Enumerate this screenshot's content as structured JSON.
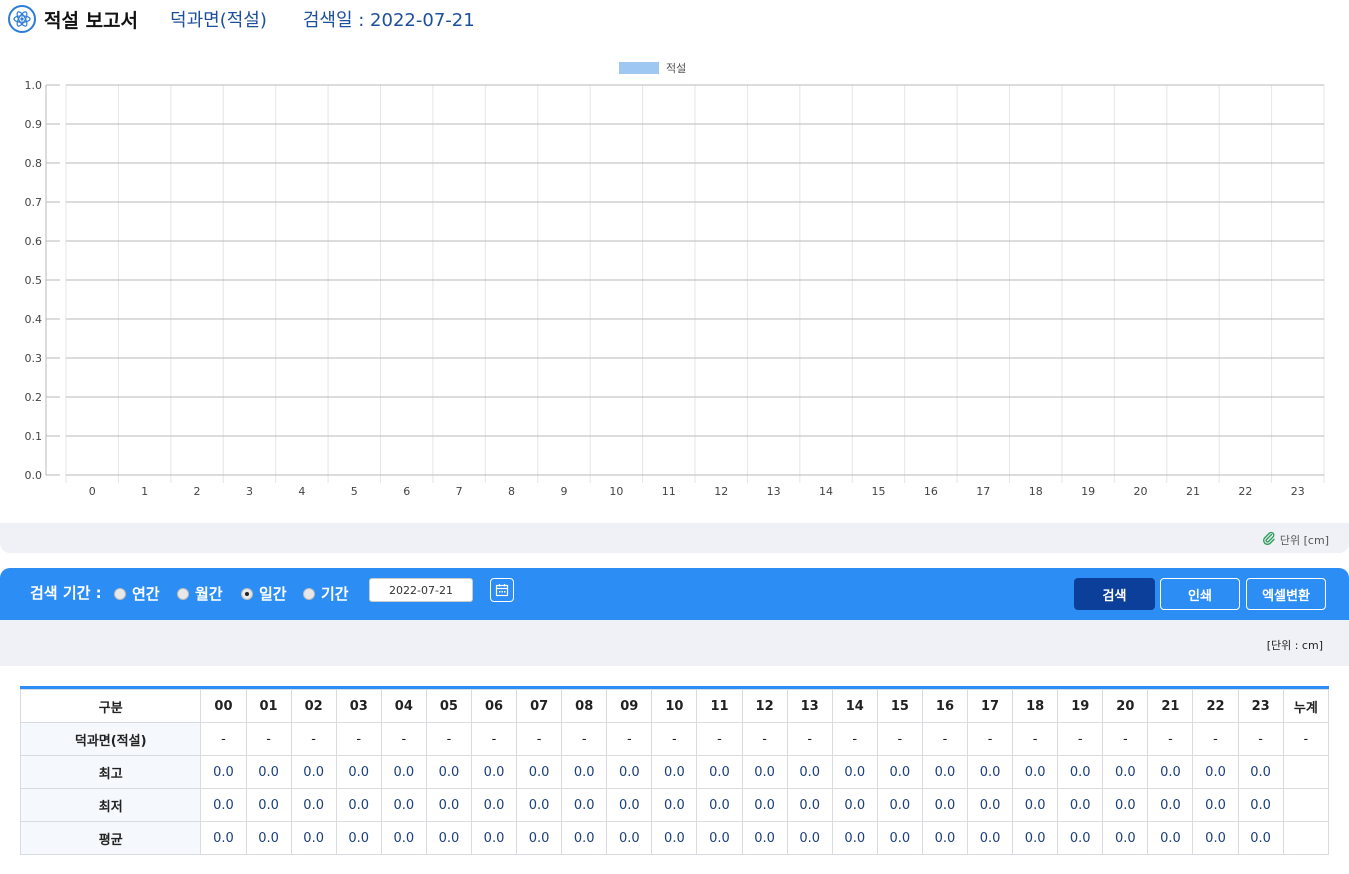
{
  "header": {
    "title": "적설 보고서",
    "station": "덕과면(적설)",
    "search_date_label": "검색일 : 2022-07-21"
  },
  "chart_data": {
    "type": "bar",
    "legend": [
      "적설"
    ],
    "series": [
      {
        "name": "적설",
        "color": "#9ec7f2",
        "values": [
          0,
          0,
          0,
          0,
          0,
          0,
          0,
          0,
          0,
          0,
          0,
          0,
          0,
          0,
          0,
          0,
          0,
          0,
          0,
          0,
          0,
          0,
          0,
          0
        ]
      }
    ],
    "categories": [
      "0",
      "1",
      "2",
      "3",
      "4",
      "5",
      "6",
      "7",
      "8",
      "9",
      "10",
      "11",
      "12",
      "13",
      "14",
      "15",
      "16",
      "17",
      "18",
      "19",
      "20",
      "21",
      "22",
      "23"
    ],
    "y_ticks": [
      "0.0",
      "0.1",
      "0.2",
      "0.3",
      "0.4",
      "0.5",
      "0.6",
      "0.7",
      "0.8",
      "0.9",
      "1.0"
    ],
    "ylim": [
      0,
      1.0
    ],
    "grid": true,
    "legend_position": "top-center"
  },
  "chart_unit": "단위 [cm]",
  "search": {
    "label": "검색 기간 :",
    "radios": [
      {
        "label": "연간",
        "checked": false
      },
      {
        "label": "월간",
        "checked": false
      },
      {
        "label": "일간",
        "checked": true
      },
      {
        "label": "기간",
        "checked": false
      }
    ],
    "date_value": "2022-07-21",
    "buttons": {
      "search": "검색",
      "print": "인쇄",
      "excel": "엑셀변환"
    }
  },
  "table_unit": "[단위 : cm]",
  "table": {
    "corner": "구분",
    "hours": [
      "00",
      "01",
      "02",
      "03",
      "04",
      "05",
      "06",
      "07",
      "08",
      "09",
      "10",
      "11",
      "12",
      "13",
      "14",
      "15",
      "16",
      "17",
      "18",
      "19",
      "20",
      "21",
      "22",
      "23"
    ],
    "total_header": "누계",
    "rows": [
      {
        "label": "덕과면(적설)",
        "values": [
          "-",
          "-",
          "-",
          "-",
          "-",
          "-",
          "-",
          "-",
          "-",
          "-",
          "-",
          "-",
          "-",
          "-",
          "-",
          "-",
          "-",
          "-",
          "-",
          "-",
          "-",
          "-",
          "-",
          "-"
        ],
        "total": "-"
      },
      {
        "label": "최고",
        "values": [
          "0.0",
          "0.0",
          "0.0",
          "0.0",
          "0.0",
          "0.0",
          "0.0",
          "0.0",
          "0.0",
          "0.0",
          "0.0",
          "0.0",
          "0.0",
          "0.0",
          "0.0",
          "0.0",
          "0.0",
          "0.0",
          "0.0",
          "0.0",
          "0.0",
          "0.0",
          "0.0",
          "0.0"
        ],
        "total": ""
      },
      {
        "label": "최저",
        "values": [
          "0.0",
          "0.0",
          "0.0",
          "0.0",
          "0.0",
          "0.0",
          "0.0",
          "0.0",
          "0.0",
          "0.0",
          "0.0",
          "0.0",
          "0.0",
          "0.0",
          "0.0",
          "0.0",
          "0.0",
          "0.0",
          "0.0",
          "0.0",
          "0.0",
          "0.0",
          "0.0",
          "0.0"
        ],
        "total": ""
      },
      {
        "label": "평균",
        "values": [
          "0.0",
          "0.0",
          "0.0",
          "0.0",
          "0.0",
          "0.0",
          "0.0",
          "0.0",
          "0.0",
          "0.0",
          "0.0",
          "0.0",
          "0.0",
          "0.0",
          "0.0",
          "0.0",
          "0.0",
          "0.0",
          "0.0",
          "0.0",
          "0.0",
          "0.0",
          "0.0",
          "0.0"
        ],
        "total": ""
      }
    ]
  }
}
